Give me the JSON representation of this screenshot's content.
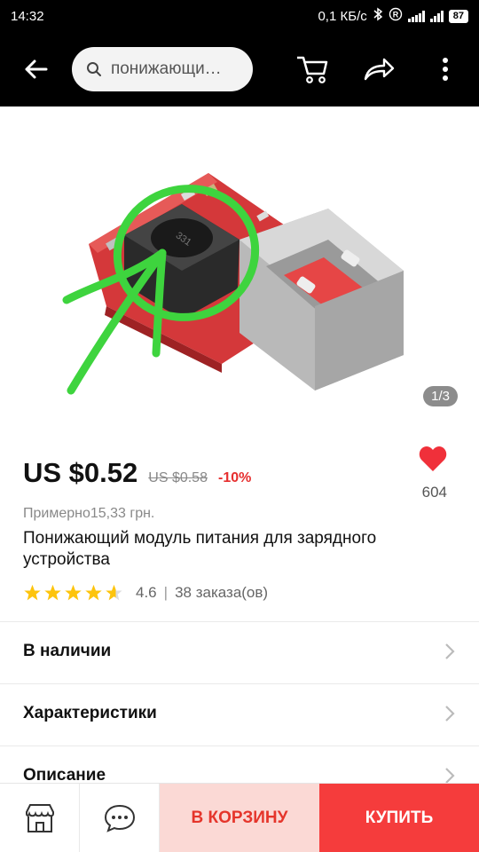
{
  "status_bar": {
    "time": "14:32",
    "network_speed": "0,1 КБ/с",
    "battery": "87"
  },
  "header": {
    "search_query": "понижающи…",
    "icons": [
      "back-arrow-icon",
      "search-icon",
      "cart-icon",
      "share-icon",
      "more-vert-icon"
    ]
  },
  "gallery": {
    "counter": "1/3",
    "image": "power-module-photo"
  },
  "product": {
    "price": "US $0.52",
    "old_price": "US $0.58",
    "discount": "-10%",
    "favorites_count": "604",
    "approx_price": "Примерно15,33 грн.",
    "title": "Понижающий модуль питания для зарядного устройства",
    "rating": "4.6",
    "orders": "38 заказа(ов)",
    "stars_filled": 4.6
  },
  "sections": [
    {
      "label": "В наличии"
    },
    {
      "label": "Характеристики"
    },
    {
      "label": "Описание"
    }
  ],
  "bottom_bar": {
    "add_to_cart": "В КОРЗИНУ",
    "buy": "КУПИТЬ"
  },
  "colors": {
    "accent_red": "#f53c3c",
    "cart_bg": "#fbd9d5",
    "star": "#fdc40d"
  }
}
